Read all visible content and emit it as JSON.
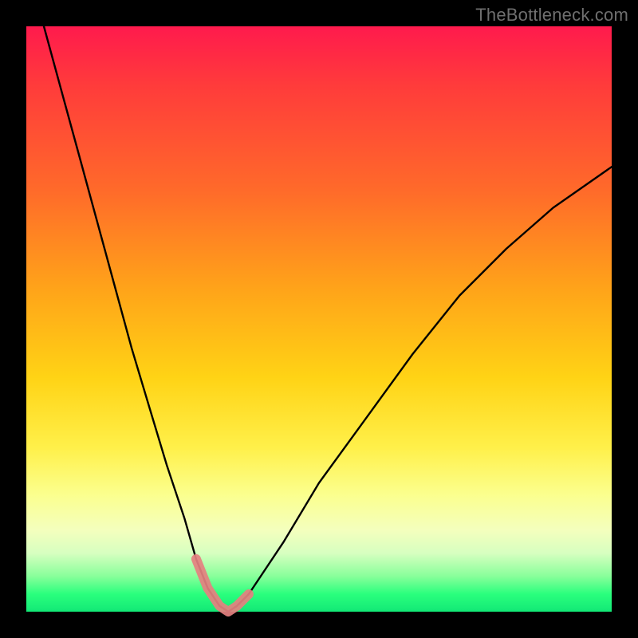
{
  "watermark": "TheBottleneck.com",
  "chart_data": {
    "type": "line",
    "title": "",
    "xlabel": "",
    "ylabel": "",
    "xlim": [
      0,
      100
    ],
    "ylim": [
      0,
      100
    ],
    "series": [
      {
        "name": "bottleneck-curve",
        "x": [
          3,
          6,
          9,
          12,
          15,
          18,
          21,
          24,
          27,
          29,
          31,
          33,
          34.5,
          36,
          38,
          40,
          44,
          50,
          58,
          66,
          74,
          82,
          90,
          100
        ],
        "y": [
          100,
          89,
          78,
          67,
          56,
          45,
          35,
          25,
          16,
          9,
          4,
          1,
          0,
          1,
          3,
          6,
          12,
          22,
          33,
          44,
          54,
          62,
          69,
          76
        ]
      },
      {
        "name": "highlight-band",
        "x": [
          29,
          31,
          33,
          34.5,
          36,
          38
        ],
        "y": [
          9,
          4,
          1,
          0,
          1,
          3
        ]
      }
    ],
    "annotations": [],
    "grid": false,
    "legend": false
  },
  "colors": {
    "curve": "#000000",
    "highlight": "#e58080",
    "frame": "#000000"
  }
}
